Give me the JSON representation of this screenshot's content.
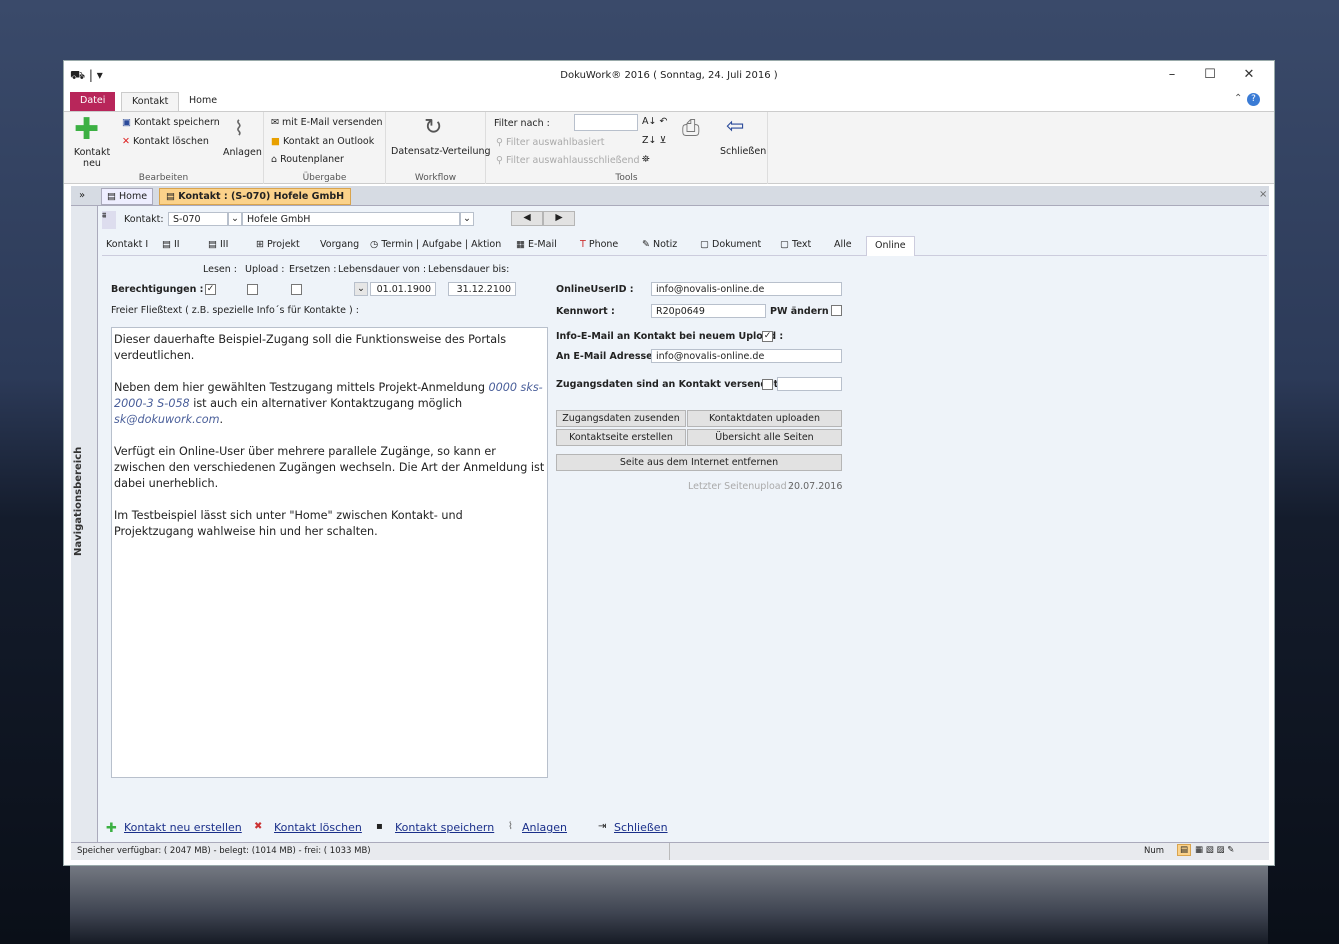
{
  "window": {
    "title": "DokuWork® 2016 ( Sonntag, 24. Juli 2016 )"
  },
  "ribbon": {
    "tabs": [
      "Datei",
      "Kontakt",
      "Home"
    ],
    "bearbeiten": {
      "label": "Bearbeiten",
      "new": "Kontakt neu",
      "save": "Kontakt speichern",
      "delete": "Kontakt löschen",
      "attach": "Anlagen"
    },
    "uebergabe": {
      "label": "Übergabe",
      "email": "mit E-Mail versenden",
      "outlook": "Kontakt an Outlook",
      "route": "Routenplaner"
    },
    "workflow": {
      "label": "Workflow",
      "dist": "Datensatz-Verteilung"
    },
    "tools": {
      "label": "Tools",
      "filter": "Filter nach :",
      "filter_sel": "Filter auswahlbasiert",
      "filter_excl": "Filter auswahlausschließend",
      "close": "Schließen"
    }
  },
  "doctabs": [
    "Home",
    "Kontakt : (S-070) Hofele GmbH"
  ],
  "nav_label": "Navigationsbereich",
  "record": {
    "label": "Kontakt:",
    "id": "S-070",
    "name": "Hofele GmbH"
  },
  "subtabs": [
    "Kontakt I",
    "II",
    "III",
    "Projekt",
    "Vorgang",
    "Termin | Aufgabe | Aktion",
    "E-Mail",
    "Phone",
    "Notiz",
    "Dokument",
    "Text",
    "Alle",
    "Online"
  ],
  "perm": {
    "headers": [
      "Lesen :",
      "Upload :",
      "Ersetzen :",
      "Lebensdauer von :",
      "Lebensdauer bis:"
    ],
    "label": "Berechtigungen :",
    "lesen": true,
    "upload": false,
    "ersetzen": false,
    "from": "01.01.1900",
    "to": "31.12.2100"
  },
  "memo": {
    "label": "Freier Fließtext ( z.B. spezielle Info´s für Kontakte ) :",
    "p1": "Dieser dauerhafte Beispiel-Zugang soll die Funktionsweise des Portals verdeutlichen.",
    "p2a": "Neben dem hier gewählten Testzugang mittels Projekt-Anmeldung ",
    "p2link": "0000 sks-2000-3 S-058",
    "p2b": " ist auch ein alternativer Kontaktzugang möglich ",
    "p2mail": "sk@dokuwork.com",
    "p2c": ".",
    "p3": "Verfügt ein Online-User über mehrere parallele Zugänge, so kann er zwischen den verschiedenen Zugängen wechseln. Die Art der Anmeldung ist dabei unerheblich.",
    "p4": "Im Testbeispiel lässt sich unter \"Home\" zwischen Kontakt- und Projektzugang wahlweise hin und her schalten."
  },
  "online": {
    "uid_label": "OnlineUserID :",
    "uid": "info@novalis-online.de",
    "pw_label": "Kennwort :",
    "pw": "R20p0649",
    "pw_change": "PW ändern :",
    "info_label": "Info-E-Mail an Kontakt bei neuem Upload :",
    "info_checked": true,
    "mail_label": "An E-Mail Adresse :",
    "mail": "info@novalis-online.de",
    "sent_label": "Zugangsdaten sind an Kontakt versendet :",
    "buttons": [
      "Zugangsdaten zusenden",
      "Kontaktdaten uploaden",
      "Kontaktseite erstellen",
      "Übersicht alle Seiten",
      "Seite aus dem Internet entfernen"
    ],
    "last_label": "Letzter Seitenupload :",
    "last": "20.07.2016"
  },
  "footer_links": [
    "Kontakt neu erstellen",
    "Kontakt löschen",
    "Kontakt speichern",
    "Anlagen",
    "Schließen"
  ],
  "status": {
    "mem": "Speicher verfügbar: ( 2047 MB)  -  belegt: (1014 MB)  -  frei: ( 1033 MB)",
    "num": "Num"
  }
}
